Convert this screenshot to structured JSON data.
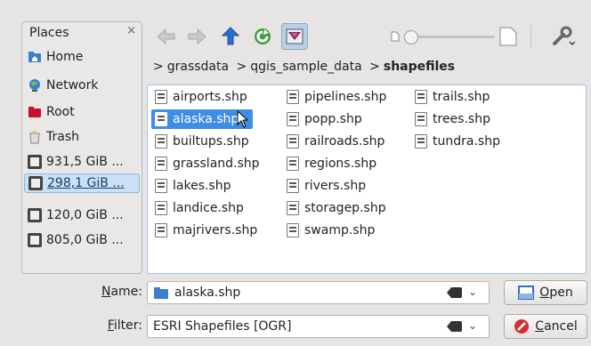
{
  "places": {
    "header": "Places",
    "close_symbol": "×",
    "items": [
      {
        "label": "Home",
        "icon": "home-folder-icon"
      },
      {
        "label": "Network",
        "icon": "network-globe-icon"
      },
      {
        "label": "Root",
        "icon": "red-folder-icon"
      },
      {
        "label": "Trash",
        "icon": "trash-icon"
      },
      {
        "label": "931,5 GiB ...",
        "icon": "hard-drive-icon"
      },
      {
        "label": "298,1 GiB ...",
        "icon": "hard-drive-icon",
        "selected": true
      },
      {
        "label": "120,0 GiB ...",
        "icon": "hard-drive-icon"
      },
      {
        "label": "805,0 GiB ...",
        "icon": "hard-drive-icon"
      }
    ]
  },
  "breadcrumb": {
    "items": [
      "grassdata",
      "qgis_sample_data",
      "shapefiles"
    ],
    "separator": ">"
  },
  "files": {
    "col1": [
      "airports.shp",
      "alaska.shp",
      "builtups.shp",
      "grassland.shp",
      "lakes.shp",
      "landice.shp",
      "majrivers.shp"
    ],
    "col2": [
      "pipelines.shp",
      "popp.shp",
      "railroads.shp",
      "regions.shp",
      "rivers.shp",
      "storagep.shp",
      "swamp.shp"
    ],
    "col3": [
      "trails.shp",
      "trees.shp",
      "tundra.shp"
    ],
    "selected": "alaska.shp"
  },
  "name_row": {
    "label_prefix": "",
    "label_u": "N",
    "label_rest": "ame:",
    "value": "alaska.shp"
  },
  "filter_row": {
    "label_u": "F",
    "label_rest": "ilter:",
    "value": "ESRI Shapefiles [OGR]"
  },
  "buttons": {
    "open": {
      "u": "O",
      "rest": "pen"
    },
    "cancel": {
      "u": "C",
      "rest": "ancel"
    }
  },
  "colors": {
    "accent": "#3d8ee4",
    "selection_light": "#cbe0f5"
  }
}
